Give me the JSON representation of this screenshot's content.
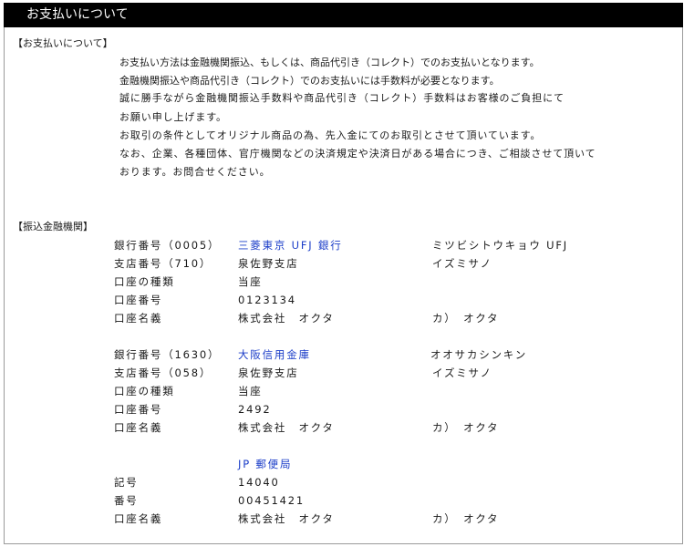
{
  "title": "お支払いについて",
  "payment": {
    "heading": "【お支払いについて】",
    "lines": [
      "お支払い方法は金融機関振込、もしくは、商品代引き（コレクト）でのお支払いとなります。",
      "金融機関振込や商品代引き（コレクト）でのお支払いには手数料が必要となります。",
      "誠に勝手ながら金融機関振込手数料や商品代引き（コレクト）手数料はお客様のご負担にて",
      "お願い申し上げます。",
      "お取引の条件としてオリジナル商品の為、先入金にてのお取引とさせて頂いています。",
      "なお、企業、各種団体、官庁機関などの決済規定や決済日がある場合につき、ご相談させて頂いて",
      "おります。お問合せください。"
    ]
  },
  "banks": {
    "heading": "【振込金融機関】",
    "mufg": {
      "bank_label": "銀行番号（0005）",
      "bank_name": "三菱東京 UFJ 銀行",
      "bank_kana": "ミツビシトウキョウ UFJ",
      "branch_label": "支店番号（710）",
      "branch_name": "泉佐野支店",
      "branch_kana": "イズミサノ",
      "type_label": "口座の種類",
      "type_value": "当座",
      "number_label": "口座番号",
      "number_value": "0123134",
      "holder_label": "口座名義",
      "holder_value": "株式会社　オクタ",
      "holder_kana": "カ）　オクタ"
    },
    "osaka": {
      "bank_label": "銀行番号（1630）",
      "bank_name": "大阪信用金庫",
      "bank_kana": "オオサカシンキン",
      "branch_label": "支店番号（058）",
      "branch_name": "泉佐野支店",
      "branch_kana": "イズミサノ",
      "type_label": "口座の種類",
      "type_value": "当座",
      "number_label": "口座番号",
      "number_value": "2492",
      "holder_label": "口座名義",
      "holder_value": "株式会社　オクタ",
      "holder_kana": "カ）　オクタ"
    },
    "jp": {
      "bank_name": "JP 郵便局",
      "symbol_label": "記号",
      "symbol_value": "14040",
      "number_label": "番号",
      "number_value": "00451421",
      "holder_label": "口座名義",
      "holder_value": "株式会社　オクタ",
      "holder_kana": "カ）　オクタ"
    }
  }
}
